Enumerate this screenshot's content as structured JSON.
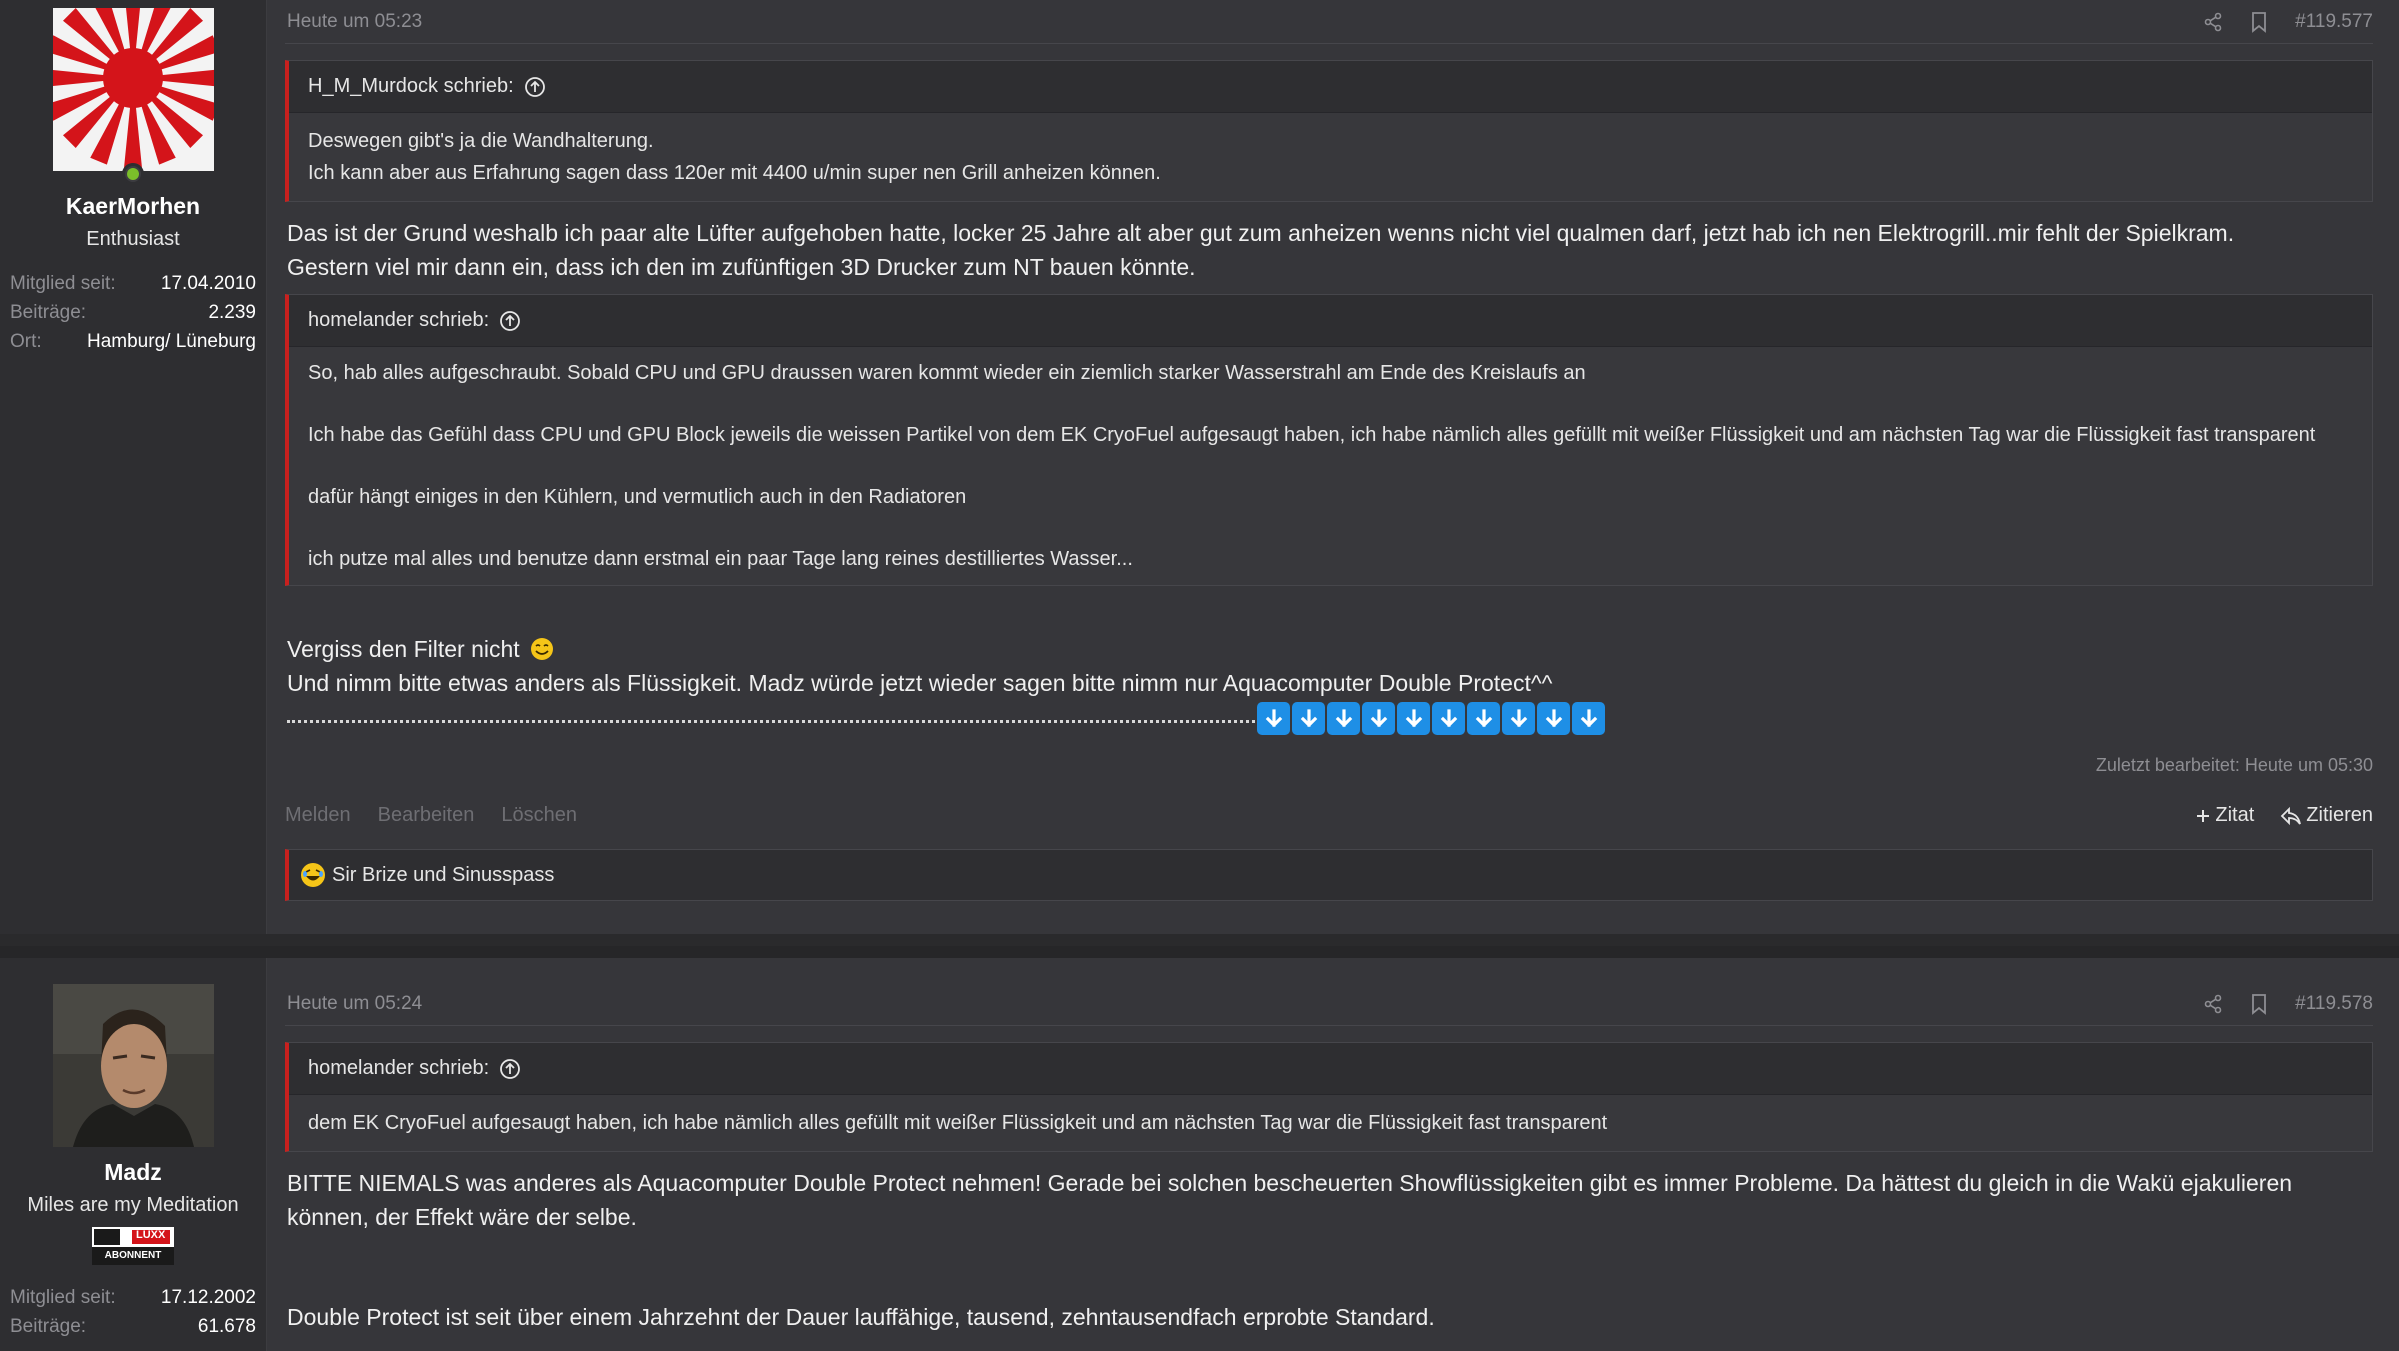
{
  "post1": {
    "user": {
      "name": "KaerMorhen",
      "title": "Enthusiast",
      "stats": [
        {
          "label": "Mitglied seit:",
          "value": "17.04.2010"
        },
        {
          "label": "Beiträge:",
          "value": "2.239"
        },
        {
          "label": "Ort:",
          "value": "Hamburg/ Lüneburg"
        }
      ]
    },
    "time": "Heute um 05:23",
    "number": "#119.577",
    "quote1": {
      "author": "H_M_Murdock schrieb:",
      "lines": [
        "Deswegen gibt's ja die Wandhalterung.",
        "Ich kann aber aus Erfahrung sagen dass 120er mit 4400 u/min super nen Grill anheizen können."
      ]
    },
    "text1": "Das ist der Grund weshalb ich paar alte Lüfter aufgehoben hatte, locker 25 Jahre alt aber gut zum anheizen wenns nicht viel qualmen darf, jetzt hab ich nen Elektrogrill..mir fehlt der Spielkram.",
    "text2": "Gestern viel mir dann ein, dass ich den im zufünftigen 3D Drucker zum NT bauen könnte.",
    "quote2": {
      "author": "homelander schrieb:",
      "paragraphs": [
        "So, hab alles aufgeschraubt. Sobald CPU und GPU draussen waren kommt wieder ein ziemlich starker Wasserstrahl am Ende des Kreislaufs an",
        "Ich habe das Gefühl dass CPU und GPU Block jeweils die weissen Partikel von dem EK CryoFuel aufgesaugt haben, ich habe nämlich alles gefüllt mit weißer Flüssigkeit und am nächsten Tag war die Flüssigkeit fast transparent",
        "dafür hängt einiges in den Kühlern, und vermutlich auch in den Radiatoren",
        "ich putze mal alles und benutze dann erstmal ein paar Tage lang reines destilliertes Wasser..."
      ]
    },
    "text3": "Vergiss den Filter nicht",
    "text4": "Und nimm bitte etwas anders als Flüssigkeit. Madz würde jetzt wieder sagen bitte nimm nur Aquacomputer Double Protect^^",
    "edited": "Zuletzt bearbeitet: Heute um 05:30",
    "actions": {
      "report": "Melden",
      "edit": "Bearbeiten",
      "delete": "Löschen",
      "plus_quote": "Zitat",
      "reply": "Zitieren"
    },
    "reactions": "Sir Brize und Sinusspass"
  },
  "post2": {
    "user": {
      "name": "Madz",
      "title": "Miles are my Meditation",
      "badge_text": "LUXX",
      "badge_sub": "ABONNENT",
      "stats": [
        {
          "label": "Mitglied seit:",
          "value": "17.12.2002"
        },
        {
          "label": "Beiträge:",
          "value": "61.678"
        }
      ]
    },
    "time": "Heute um 05:24",
    "number": "#119.578",
    "quote": {
      "author": "homelander schrieb:",
      "text": "dem EK CryoFuel aufgesaugt haben, ich habe nämlich alles gefüllt mit weißer Flüssigkeit und am nächsten Tag war die Flüssigkeit fast transparent"
    },
    "text1": "BITTE NIEMALS was anderes als Aquacomputer Double Protect nehmen! Gerade bei solchen bescheuerten Showflüssigkeiten gibt es immer Probleme. Da hättest du gleich in die Wakü ejakulieren können, der Effekt wäre der selbe.",
    "text2": "Double Protect ist seit über einem Jahrzehnt der Dauer lauffähige, tausend, zehntausendfach erprobte Standard."
  },
  "colors": {
    "accent": "#c8201e",
    "online": "#7bbf2a",
    "arrow_emoji": "#1e8fe6"
  },
  "icons": [
    "share-icon",
    "bookmark-icon",
    "arrow-up-circle-icon",
    "arrow-down-emoji-icon",
    "smile-emoji-icon",
    "laugh-emoji-icon",
    "plus-icon",
    "reply-icon"
  ]
}
